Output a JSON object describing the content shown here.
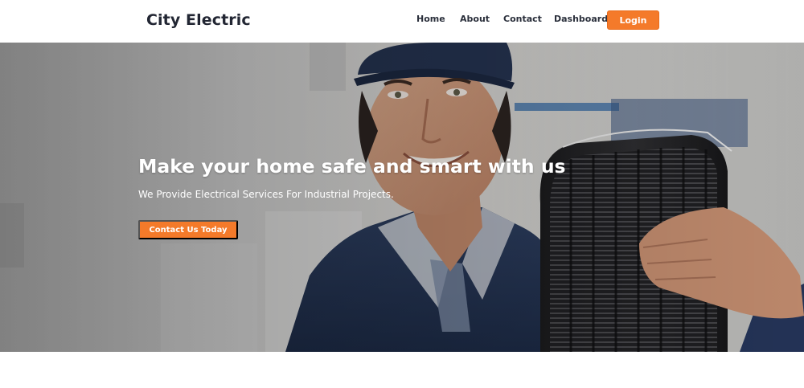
{
  "header": {
    "brand": "City Electric",
    "nav": {
      "home": "Home",
      "about": "About",
      "contact": "Contact",
      "dashboard": "Dashboard"
    },
    "login_label": "Login"
  },
  "hero": {
    "title": "Make your home safe and smart with us",
    "subtitle": "We Provide Electrical Services For Industrial Projects.",
    "cta_label": "Contact Us Today",
    "image": "electrician-holding-conduit-photo"
  },
  "colors": {
    "accent": "#f47a2a",
    "text_dark": "#222633",
    "background": "#ffffff"
  }
}
